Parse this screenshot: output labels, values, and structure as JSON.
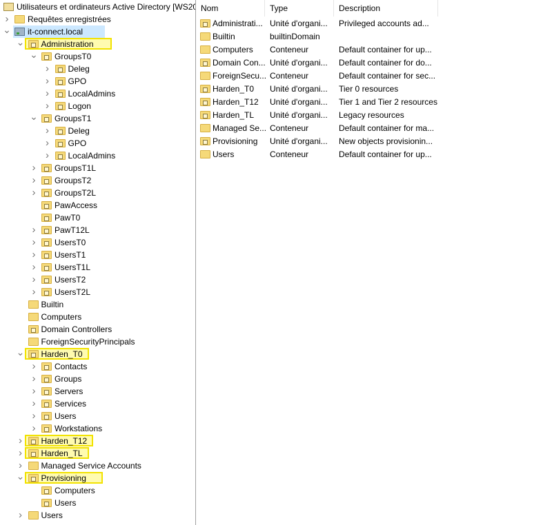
{
  "tree": [
    {
      "level": 0,
      "label": "Utilisateurs et ordinateurs Active Directory [WS20",
      "expand": "none",
      "icon": "title"
    },
    {
      "level": 1,
      "label": "Requêtes enregistrées",
      "expand": "closed",
      "icon": "folder"
    },
    {
      "level": 1,
      "label": "it-connect.local",
      "expand": "open",
      "icon": "domain",
      "selected": true
    },
    {
      "level": 2,
      "label": "Administration",
      "expand": "open",
      "icon": "ou",
      "highlight": true
    },
    {
      "level": 3,
      "label": "GroupsT0",
      "expand": "open",
      "icon": "ou"
    },
    {
      "level": 4,
      "label": "Deleg",
      "expand": "closed",
      "icon": "ou"
    },
    {
      "level": 4,
      "label": "GPO",
      "expand": "closed",
      "icon": "ou"
    },
    {
      "level": 4,
      "label": "LocalAdmins",
      "expand": "closed",
      "icon": "ou"
    },
    {
      "level": 4,
      "label": "Logon",
      "expand": "closed",
      "icon": "ou"
    },
    {
      "level": 3,
      "label": "GroupsT1",
      "expand": "open",
      "icon": "ou"
    },
    {
      "level": 4,
      "label": "Deleg",
      "expand": "closed",
      "icon": "ou"
    },
    {
      "level": 4,
      "label": "GPO",
      "expand": "closed",
      "icon": "ou"
    },
    {
      "level": 4,
      "label": "LocalAdmins",
      "expand": "closed",
      "icon": "ou"
    },
    {
      "level": 3,
      "label": "GroupsT1L",
      "expand": "closed",
      "icon": "ou"
    },
    {
      "level": 3,
      "label": "GroupsT2",
      "expand": "closed",
      "icon": "ou"
    },
    {
      "level": 3,
      "label": "GroupsT2L",
      "expand": "closed",
      "icon": "ou"
    },
    {
      "level": 3,
      "label": "PawAccess",
      "expand": "none",
      "icon": "ou"
    },
    {
      "level": 3,
      "label": "PawT0",
      "expand": "none",
      "icon": "ou"
    },
    {
      "level": 3,
      "label": "PawT12L",
      "expand": "closed",
      "icon": "ou"
    },
    {
      "level": 3,
      "label": "UsersT0",
      "expand": "closed",
      "icon": "ou"
    },
    {
      "level": 3,
      "label": "UsersT1",
      "expand": "closed",
      "icon": "ou"
    },
    {
      "level": 3,
      "label": "UsersT1L",
      "expand": "closed",
      "icon": "ou"
    },
    {
      "level": 3,
      "label": "UsersT2",
      "expand": "closed",
      "icon": "ou"
    },
    {
      "level": 3,
      "label": "UsersT2L",
      "expand": "closed",
      "icon": "ou"
    },
    {
      "level": 2,
      "label": "Builtin",
      "expand": "none",
      "icon": "folder"
    },
    {
      "level": 2,
      "label": "Computers",
      "expand": "none",
      "icon": "folder"
    },
    {
      "level": 2,
      "label": "Domain Controllers",
      "expand": "none",
      "icon": "ou"
    },
    {
      "level": 2,
      "label": "ForeignSecurityPrincipals",
      "expand": "none",
      "icon": "folder"
    },
    {
      "level": 2,
      "label": "Harden_T0",
      "expand": "open",
      "icon": "ou",
      "highlight": true
    },
    {
      "level": 3,
      "label": "Contacts",
      "expand": "closed",
      "icon": "ou"
    },
    {
      "level": 3,
      "label": "Groups",
      "expand": "closed",
      "icon": "ou"
    },
    {
      "level": 3,
      "label": "Servers",
      "expand": "closed",
      "icon": "ou"
    },
    {
      "level": 3,
      "label": "Services",
      "expand": "closed",
      "icon": "ou"
    },
    {
      "level": 3,
      "label": "Users",
      "expand": "closed",
      "icon": "ou"
    },
    {
      "level": 3,
      "label": "Workstations",
      "expand": "closed",
      "icon": "ou"
    },
    {
      "level": 2,
      "label": "Harden_T12",
      "expand": "closed",
      "icon": "ou",
      "highlight": true
    },
    {
      "level": 2,
      "label": "Harden_TL",
      "expand": "closed",
      "icon": "ou",
      "highlight": true
    },
    {
      "level": 2,
      "label": "Managed Service Accounts",
      "expand": "closed",
      "icon": "folder"
    },
    {
      "level": 2,
      "label": "Provisioning",
      "expand": "open",
      "icon": "ou",
      "highlight": true
    },
    {
      "level": 3,
      "label": "Computers",
      "expand": "none",
      "icon": "ou"
    },
    {
      "level": 3,
      "label": "Users",
      "expand": "none",
      "icon": "ou"
    },
    {
      "level": 2,
      "label": "Users",
      "expand": "closed",
      "icon": "folder"
    }
  ],
  "list": {
    "columns": [
      "Nom",
      "Type",
      "Description"
    ],
    "rows": [
      {
        "icon": "ou",
        "name": "Administrati...",
        "type": "Unité d'organi...",
        "desc": "Privileged accounts ad..."
      },
      {
        "icon": "folder",
        "name": "Builtin",
        "type": "builtinDomain",
        "desc": ""
      },
      {
        "icon": "folder",
        "name": "Computers",
        "type": "Conteneur",
        "desc": "Default container for up..."
      },
      {
        "icon": "ou",
        "name": "Domain Con...",
        "type": "Unité d'organi...",
        "desc": "Default container for do..."
      },
      {
        "icon": "folder",
        "name": "ForeignSecu...",
        "type": "Conteneur",
        "desc": "Default container for sec..."
      },
      {
        "icon": "ou",
        "name": "Harden_T0",
        "type": "Unité d'organi...",
        "desc": "Tier 0 resources"
      },
      {
        "icon": "ou",
        "name": "Harden_T12",
        "type": "Unité d'organi...",
        "desc": "Tier 1 and Tier 2 resources"
      },
      {
        "icon": "ou",
        "name": "Harden_TL",
        "type": "Unité d'organi...",
        "desc": "Legacy resources"
      },
      {
        "icon": "folder",
        "name": "Managed Se...",
        "type": "Conteneur",
        "desc": "Default container for ma..."
      },
      {
        "icon": "ou",
        "name": "Provisioning",
        "type": "Unité d'organi...",
        "desc": "New objects provisionin..."
      },
      {
        "icon": "folder",
        "name": "Users",
        "type": "Conteneur",
        "desc": "Default container for up..."
      }
    ]
  }
}
